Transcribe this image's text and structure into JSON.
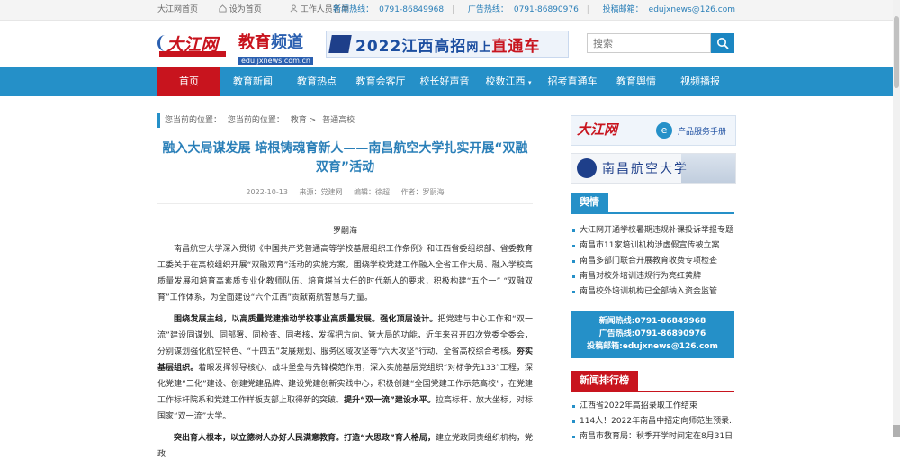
{
  "topbar": {
    "home": "大江网首页",
    "set_home": "设为首页",
    "staff_list": "工作人员名单",
    "news_hotline_label": "新闻热线：",
    "news_hotline": "0791-86849968",
    "ad_hotline_label": "广告热线：",
    "ad_hotline": "0791-86890976",
    "email_label": "投稿邮箱：",
    "email": "edujxnews@126.com"
  },
  "header": {
    "logo_text": "大江网",
    "channel_title_a": "教育",
    "channel_title_b": "频道",
    "channel_url": "edu.jxnews.com.cn",
    "banner_text_a": "2022江西高招",
    "banner_text_b": "网上",
    "banner_text_c": "直通车",
    "search_placeholder": "搜索"
  },
  "nav": {
    "items": [
      {
        "label": "首页",
        "active": true
      },
      {
        "label": "教育新闻"
      },
      {
        "label": "教育热点"
      },
      {
        "label": "教育会客厅"
      },
      {
        "label": "校长好声音"
      },
      {
        "label": "校数江西"
      },
      {
        "label": "招考直通车"
      },
      {
        "label": "教育舆情"
      },
      {
        "label": "视频播报"
      }
    ]
  },
  "breadcrumb": {
    "label1": "您当前的位置：",
    "label2": "您当前的位置：",
    "c1": "教育",
    "sep": ">",
    "c2": "普通高校"
  },
  "article": {
    "title": "融入大局谋发展 培根铸魂育新人——南昌航空大学扎实开展“双融双育”活动",
    "date": "2022-10-13",
    "source": "来源：党建网",
    "editor": "编辑：徐超",
    "author": "作者：罗嗣海",
    "byline": "罗嗣海",
    "p1": "南昌航空大学深入贯彻《中国共产党普通高等学校基层组织工作条例》和江西省委组织部、省委教育工委关于在高校组织开展“双融双育”活动的实施方案，围绕学校党建工作融入全省工作大局、融入学校高质量发展和培育高素质专业化教师队伍、培育堪当大任的时代新人的要求，积极构建“五个一” “双融双育”工作体系，为全面建设“六个江西”贡献南航智慧与力量。",
    "p2_bold1": "围绕发展主线，以高质量党建推动学校事业高质量发展。强化顶层设计。",
    "p2_a": "把党建与中心工作和“双一流”建设同谋划、同部署、同检查、同考核，发挥把方向、管大局的功能，近年来召开四次党委全委会，分别谋划强化航空特色、“十四五”发展规划、服务区域攻坚等“六大攻坚”行动、全省高校综合考核。",
    "p2_bold2": "夯实基层组织。",
    "p2_b": "着眼发挥领导核心、战斗堡垒与先锋模范作用，深入实施基层党组织“对标争先133”工程，深化党建“三化”建设、创建党建品牌、建设党建创新实践中心，积极创建“全国党建工作示范高校”，在党建工作标杆院系和党建工作样板支部上取得新的突破。",
    "p2_bold3": "提升“双一流”建设水平。",
    "p2_c": "拉高标杆、放大坐标，对标国家“双一流”大学。",
    "p3_bold": "突出育人根本，以立德树人办好人民满意教育。打造“大思政”育人格局，",
    "p3_a": "建立党政同责组织机构，党政"
  },
  "sidebar": {
    "ad1_logo": "大江网",
    "ad1_icon": "e",
    "ad1_text": "产品服务手册",
    "ad2_text": "南昌航空大学",
    "sec1_title": "舆情",
    "sec1_items": [
      "大江网开通学校暑期违规补课投诉举报专题",
      "南昌市11家培训机构涉虚假宣传被立案",
      "南昌多部门联合开展教育收费专项检查",
      "南昌对校外培训违规行为亮红黄牌",
      "南昌校外培训机构已全部纳入资金监管"
    ],
    "hotline1": "新闻热线:0791-86849968",
    "hotline2": "广告热线:0791-86890976",
    "hotline3": "投稿邮箱:edujxnews@126.com",
    "sec2_title": "新闻排行榜",
    "sec2_items": [
      "江西省2022年高招录取工作结束",
      "114人！2022年南昌中招定向师范生预录...",
      "南昌市教育局：秋季开学时间定在8月31日"
    ]
  },
  "colors": {
    "nav_blue": "#2590c8",
    "brand_red": "#c8141e",
    "link_blue": "#2a7fb8"
  }
}
